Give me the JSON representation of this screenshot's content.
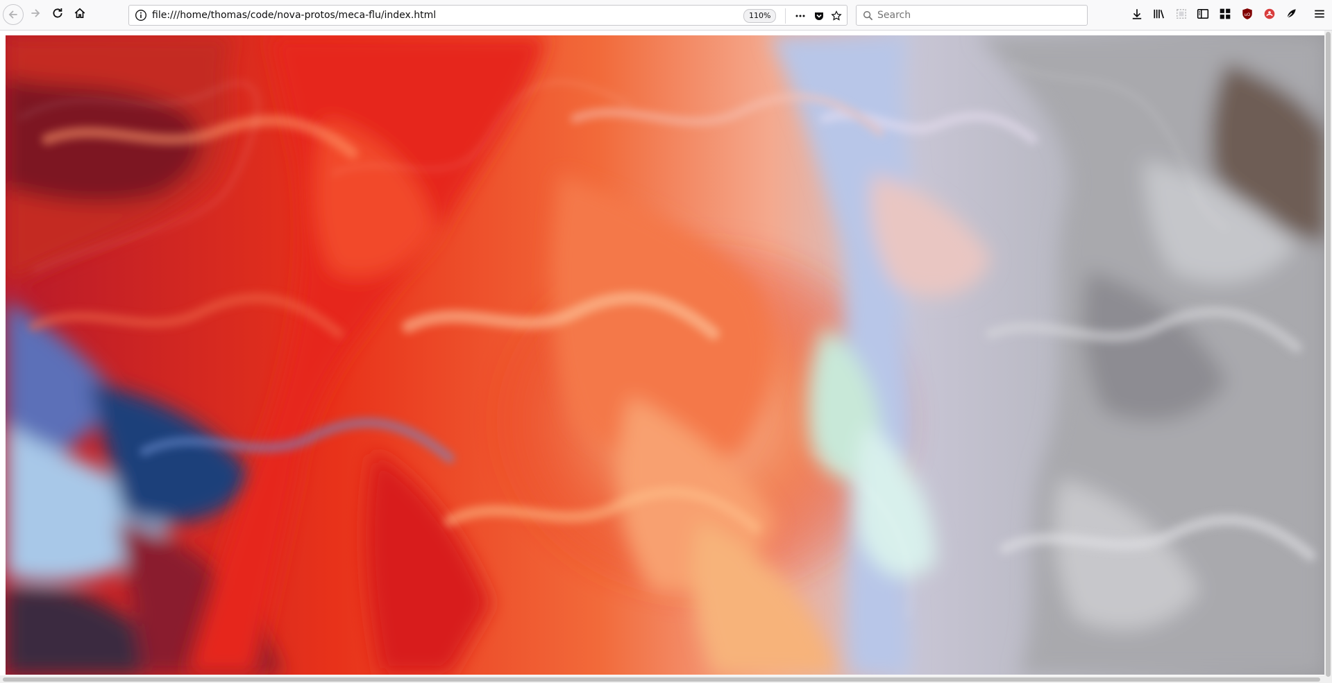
{
  "toolbar": {
    "url": "file:///home/thomas/code/nova-protos/meca-flu/index.html",
    "zoom": "110%",
    "search_placeholder": "Search"
  },
  "icons": {
    "back": "back-arrow-icon",
    "forward": "forward-arrow-icon",
    "reload": "reload-icon",
    "home": "home-icon",
    "info": "info-icon",
    "page_actions": "more-dots-icon",
    "pocket": "pocket-icon",
    "bookmark": "star-icon",
    "search": "search-icon",
    "downloads": "download-icon",
    "library": "library-icon",
    "screenshot": "screenshot-icon",
    "sidebar": "sidebar-icon",
    "containers": "grid-icon",
    "ublock": "ublock-icon",
    "extension_red": "extension-icon",
    "extension_dark": "extension-leaf-icon",
    "menu": "hamburger-menu-icon"
  },
  "colors": {
    "chrome_bg": "#f9f9fa",
    "ublock": "#800000",
    "extension_red": "#d83d3d"
  }
}
